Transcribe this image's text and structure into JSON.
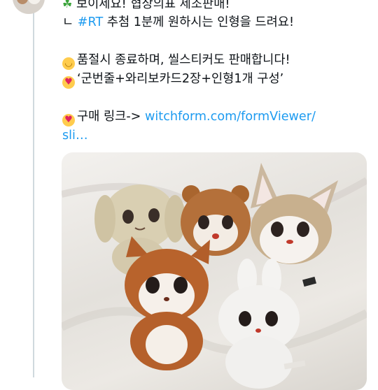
{
  "tweet": {
    "line1": "보이세요! 협상의표 제조판매!",
    "line2_prefix": "ㄴ ",
    "line2_hashtag": "#RT",
    "line2_rest": " 추첨 1분께 원하시는 인형을 드려요!",
    "line3": "품절시 종료하며, 씰스티커도 판매합니다!",
    "line4": "‘군번줄+와리보카드2장+인형1개 구성’",
    "line5_prefix": "구매 링크-> ",
    "link_text_1": "witchform.com/formViewer/",
    "link_text_2": "sli…"
  },
  "icons": {
    "clover": "four-leaf-clover-emoji",
    "smile": "relieved-face-emoji",
    "hearts": "smiling-face-with-hearts-emoji",
    "kiss": "kissing-face-emoji"
  },
  "colors": {
    "link": "#1d9bf0",
    "thread": "#cfd9de",
    "text": "#0f1419"
  }
}
